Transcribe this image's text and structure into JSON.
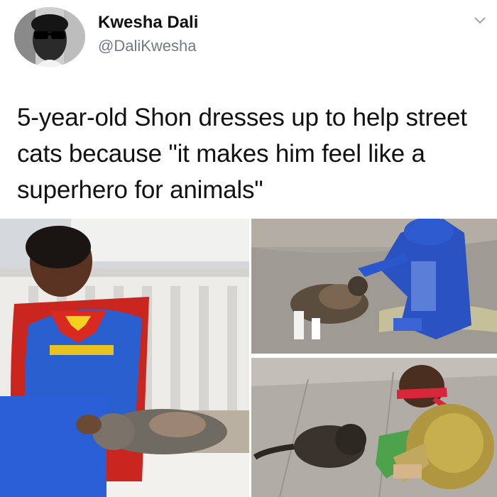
{
  "tweet": {
    "author_name": "Kwesha Dali",
    "author_handle": "@DaliKwesha",
    "text": "5-year-old Shon dresses up to help street cats because \"it makes him feel like a superhero for animals\""
  },
  "icons": {
    "menu": "chevron-down-icon"
  },
  "colors": {
    "name": "#111111",
    "handle": "#6f7a84",
    "background": "#ffffff"
  },
  "photos": [
    {
      "id": "photo-1",
      "subject": "boy in superman costume petting cat on bench"
    },
    {
      "id": "photo-2",
      "subject": "child in blue costume petting cat on pavement"
    },
    {
      "id": "photo-3",
      "subject": "boy in turtle costume petting cat on sidewalk"
    }
  ]
}
